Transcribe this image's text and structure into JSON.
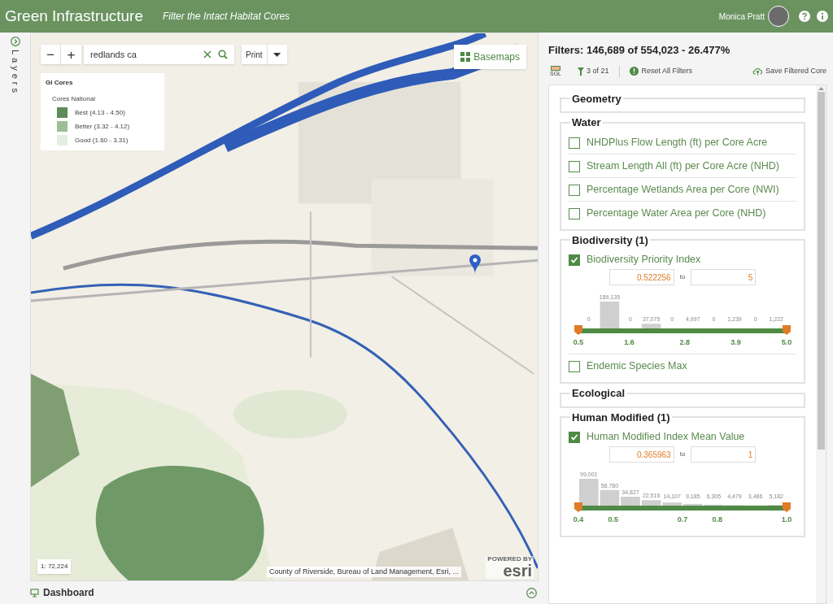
{
  "header": {
    "title": "Green Infrastructure",
    "subtitle": "Filter the Intact Habitat Cores",
    "user_name": "Monica Pratt"
  },
  "layers_tab": {
    "label": "Layers"
  },
  "map": {
    "zoom_out": "−",
    "zoom_in": "+",
    "search": {
      "value": "redlands ca"
    },
    "print": "Print",
    "basemaps": "Basemaps",
    "legend": {
      "title": "GI Cores",
      "subtitle": "Cores National",
      "items": [
        {
          "label": "Best (4.13 - 4.50)",
          "color": "#5e8b5a"
        },
        {
          "label": "Better (3.32 - 4.12)",
          "color": "#9cbf96"
        },
        {
          "label": "Good (1.60 - 3.31)",
          "color": "#e3efe1"
        }
      ]
    },
    "scale": "1: 72,224",
    "attribution": "County of Riverside, Bureau of Land Management, Esri, ...",
    "logo": {
      "small": "POWERED BY",
      "text": "esri"
    }
  },
  "dashboard": {
    "label": "Dashboard"
  },
  "filters": {
    "summary": "Filters: 146,689 of 554,023 - 26.477%",
    "sgl": "SGL",
    "count": "3 of 21",
    "reset": "Reset All Filters",
    "save": "Save Filtered Core",
    "groups": [
      {
        "title": "Geometry"
      },
      {
        "title": "Water",
        "items": [
          {
            "label": "NHDPlus Flow Length (ft) per Core Acre",
            "checked": false
          },
          {
            "label": "Stream Length All (ft) per Core Acre (NHD)",
            "checked": false
          },
          {
            "label": "Percentage Wetlands Area per Core (NWI)",
            "checked": false
          },
          {
            "label": "Percentage Water Area per Core (NHD)",
            "checked": false
          }
        ]
      },
      {
        "title": "Biodiversity (1)",
        "items": [
          {
            "label": "Biodiversity Priority Index",
            "checked": true,
            "range": {
              "min": "0.522256",
              "to": "to",
              "max": "5",
              "chart_data": {
                "type": "bar",
                "x": [
                  0.725,
                  1.175,
                  1.625,
                  2.075,
                  2.525,
                  2.975,
                  3.425,
                  3.875,
                  4.325,
                  4.775
                ],
                "values": [
                  0,
                  189135,
                  0,
                  37075,
                  0,
                  4997,
                  0,
                  1239,
                  0,
                  1222
                ],
                "value_labels": [
                  "0",
                  "189,135",
                  "0",
                  "37,075",
                  "0",
                  "4,997",
                  "0",
                  "1,239",
                  "0",
                  "1,222"
                ],
                "data_labels": true,
                "xlim": [
                  0.5,
                  5.0
                ],
                "xticks": [
                  {
                    "value": 0.5,
                    "label": "0.5"
                  },
                  {
                    "value": 1.6,
                    "label": "1.6"
                  },
                  {
                    "value": 2.8,
                    "label": "2.8"
                  },
                  {
                    "value": 3.9,
                    "label": "3.9"
                  },
                  {
                    "value": 5.0,
                    "label": "5.0"
                  }
                ]
              }
            }
          },
          {
            "label": "Endemic Species Max",
            "checked": false
          }
        ]
      },
      {
        "title": "Ecological"
      },
      {
        "title": "Human Modified (1)",
        "items": [
          {
            "label": "Human Modified Index Mean Value",
            "checked": true,
            "range": {
              "min": "0.365963",
              "to": "to",
              "max": "1",
              "chart_data": {
                "type": "bar",
                "x": [
                  0.43,
                  0.49,
                  0.55,
                  0.61,
                  0.67,
                  0.73,
                  0.79,
                  0.85,
                  0.91,
                  0.97
                ],
                "values": [
                  99001,
                  58780,
                  34827,
                  22516,
                  14107,
                  9185,
                  6305,
                  4479,
                  3486,
                  5182
                ],
                "value_labels": [
                  "99,001",
                  "58,780",
                  "34,827",
                  "22,516",
                  "14,107",
                  "9,185",
                  "6,305",
                  "4,479",
                  "3,486",
                  "5,182"
                ],
                "data_labels": true,
                "xlim": [
                  0.4,
                  1.0
                ],
                "xticks": [
                  {
                    "value": 0.4,
                    "label": "0.4"
                  },
                  {
                    "value": 0.5,
                    "label": "0.5"
                  },
                  {
                    "value": 0.7,
                    "label": "0.7"
                  },
                  {
                    "value": 0.8,
                    "label": "0.8"
                  },
                  {
                    "value": 1.0,
                    "label": "1.0"
                  }
                ]
              }
            }
          }
        ]
      }
    ]
  }
}
